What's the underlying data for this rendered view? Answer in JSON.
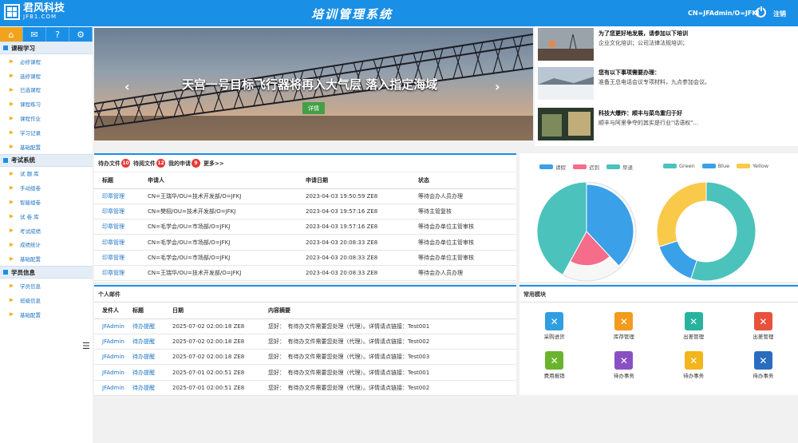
{
  "header": {
    "logo_name": "君风科技",
    "logo_sub": "JFB1.COM",
    "title": "培训管理系统",
    "user": "CN=JFAdmin/O=JFKJ",
    "logout": "注销"
  },
  "sidebar": {
    "sections": [
      {
        "title": "课程学习",
        "items": [
          "必修课程",
          "选修课程",
          "已选课程",
          "课程练习",
          "课程作业",
          "学习记录",
          "基础配置"
        ]
      },
      {
        "title": "考试系统",
        "items": [
          "试 题 库",
          "手动组卷",
          "智能组卷",
          "试 卷 库",
          "考试成绩",
          "成绩统计",
          "基础配置"
        ]
      },
      {
        "title": "学员信息",
        "items": [
          "学员信息",
          "班级信息",
          "基础配置"
        ]
      }
    ]
  },
  "banner": {
    "title": "天宫一号目标飞行器将再入大气层 落入指定海域",
    "button": "详情"
  },
  "news": [
    {
      "title": "为了您更好地发展，请参加以下培训",
      "desc": "企业文化培训；公司法律法规培训；"
    },
    {
      "title": "您有以下事项需要办理：",
      "desc": "准备王总电话会议专项材料，九点参加会议。"
    },
    {
      "title": "科技大爆炸：顺丰与菜鸟重归于好",
      "desc": "顺丰与阿里争夺的其实是行业\"话语权\"..."
    }
  ],
  "tasks": {
    "tabs": [
      {
        "label": "待办文件",
        "count": "10"
      },
      {
        "label": "待阅文件",
        "count": "12"
      },
      {
        "label": "我的申请",
        "count": "9"
      }
    ],
    "more": "更多>>",
    "columns": [
      "标题",
      "申请人",
      "申请日期",
      "状态"
    ],
    "rows": [
      [
        "印章管理",
        "CN=王瑞华/OU=技术开发部/O=JFKJ",
        "2023-04-03 19:50:59 ZE8",
        "等待会办人员办理"
      ],
      [
        "印章管理",
        "CN=樊栩/OU=技术开发部/O=JFKJ",
        "2023-04-03 19:57:16 ZE8",
        "等待主管复核"
      ],
      [
        "印章管理",
        "CN=毛学会/OU=市场部/O=JFKJ",
        "2023-04-03 19:57:16 ZE8",
        "等待会办单位主管审核"
      ],
      [
        "印章管理",
        "CN=毛学会/OU=市场部/O=JFKJ",
        "2023-04-03 20:08:33 ZE8",
        "等待会办单位主管审核"
      ],
      [
        "印章管理",
        "CN=毛学会/OU=市场部/O=JFKJ",
        "2023-04-03 20:08:33 ZE8",
        "等待会办单位主管审核"
      ],
      [
        "印章管理",
        "CN=王瑞华/OU=技术开发部/O=JFKJ",
        "2023-04-03 20:08:33 ZE8",
        "等待会办人员办理"
      ]
    ]
  },
  "mail": {
    "title": "个人邮件",
    "columns": [
      "发件人",
      "标题",
      "日期",
      "内容摘要"
    ],
    "rows": [
      [
        "JFAdmin",
        "待办提醒",
        "2025-07-02 02:00:18 ZE8",
        "您好：　有待办文件需要您处理（代理）。详情请点链接：Test001"
      ],
      [
        "JFAdmin",
        "待办提醒",
        "2025-07-02 02:00:18 ZE8",
        "您好：　有待办文件需要您处理（代理）。详情请点链接：Test002"
      ],
      [
        "JFAdmin",
        "待办提醒",
        "2025-07-02 02:00:18 ZE8",
        "您好：　有待办文件需要您处理（代理）。详情请点链接：Test003"
      ],
      [
        "JFAdmin",
        "待办提醒",
        "2025-07-01 02:00:51 ZE8",
        "您好：　有待办文件需要您处理（代理）。详情请点链接：Test001"
      ],
      [
        "JFAdmin",
        "待办提醒",
        "2025-07-01 02:00:51 ZE8",
        "您好：　有待办文件需要您处理（代理）。详情请点链接：Test002"
      ]
    ]
  },
  "chart_data": [
    {
      "type": "pie",
      "variant": "rose",
      "series": [
        {
          "name": "请假",
          "value": 38,
          "color": "#3aa0e8"
        },
        {
          "name": "迟到",
          "value": 20,
          "color": "#f56d8a"
        },
        {
          "name": "早退",
          "value": 42,
          "color": "#4bc2bb"
        }
      ]
    },
    {
      "type": "pie",
      "variant": "donut",
      "series": [
        {
          "name": "Green",
          "value": 55,
          "color": "#4bc2bb"
        },
        {
          "name": "Blue",
          "value": 15,
          "color": "#3aa0e8"
        },
        {
          "name": "Yellow",
          "value": 30,
          "color": "#f9c94a"
        }
      ]
    }
  ],
  "modules": {
    "title": "常用模块",
    "items": [
      {
        "label": "采购进货",
        "color": "#2f9fe0"
      },
      {
        "label": "库存管理",
        "color": "#f29b1d"
      },
      {
        "label": "出差管理",
        "color": "#28b3a0"
      },
      {
        "label": "出差管理",
        "color": "#e8523c"
      },
      {
        "label": "费用报销",
        "color": "#6ab42d"
      },
      {
        "label": "待办事务",
        "color": "#8b4fc4"
      },
      {
        "label": "待办事务",
        "color": "#f2b51b"
      },
      {
        "label": "待办事务",
        "color": "#2a6cc0"
      }
    ]
  }
}
